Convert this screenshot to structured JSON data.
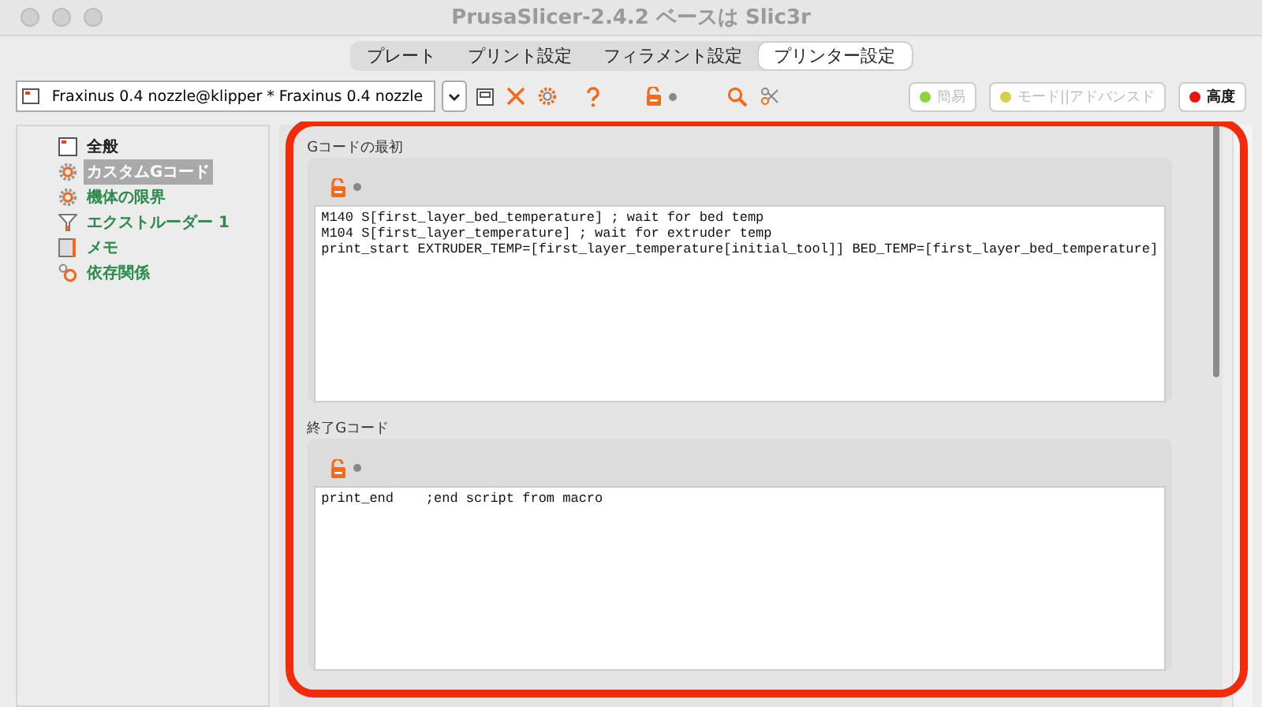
{
  "window": {
    "title": "PrusaSlicer-2.4.2 ベースは Slic3r"
  },
  "tabs": [
    {
      "label": "プレート",
      "selected": false
    },
    {
      "label": "プリント設定",
      "selected": false
    },
    {
      "label": "フィラメント設定",
      "selected": false
    },
    {
      "label": "プリンター設定",
      "selected": true
    }
  ],
  "preset": {
    "value": "Fraxinus 0.4 nozzle@klipper * Fraxinus 0.4 nozzle"
  },
  "mode_buttons": [
    {
      "label": "簡易",
      "color": "#8fd13f",
      "selected": false
    },
    {
      "label": "モード||アドバンスド",
      "color": "#d6cf4a",
      "selected": false
    },
    {
      "label": "高度",
      "color": "#e8160c",
      "selected": true
    }
  ],
  "sidebar": {
    "items": [
      {
        "label": "全般",
        "kind": "page",
        "color": "#222222",
        "selected": false
      },
      {
        "label": "カスタムGコード",
        "kind": "gear",
        "selected": true
      },
      {
        "label": "機体の限界",
        "kind": "gear",
        "color": "#2f8a4e",
        "selected": false
      },
      {
        "label": "エクストルーダー 1",
        "kind": "funnel",
        "color": "#2f8a4e",
        "selected": false
      },
      {
        "label": "メモ",
        "kind": "note",
        "color": "#2f8a4e",
        "selected": false
      },
      {
        "label": "依存関係",
        "kind": "gears",
        "color": "#2f8a4e",
        "selected": false
      }
    ]
  },
  "sections": [
    {
      "title": "Gコードの最初",
      "code": [
        "M140 S[first_layer_bed_temperature] ; wait for bed temp",
        "M104 S[first_layer_temperature] ; wait for extruder temp",
        "print_start EXTRUDER_TEMP=[first_layer_temperature[initial_tool]] BED_TEMP=[first_layer_bed_temperature]"
      ]
    },
    {
      "title": "終了Gコード",
      "code": [
        "print_end    ;end script from macro"
      ]
    }
  ]
}
